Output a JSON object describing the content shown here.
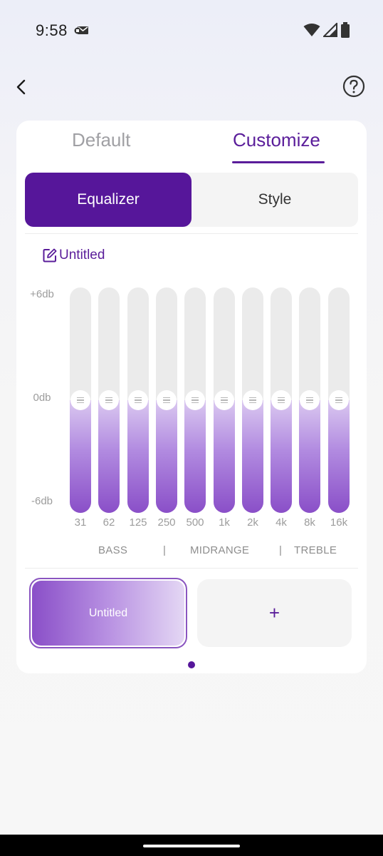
{
  "status_bar": {
    "time": "9:58",
    "icons": [
      "notification-icon",
      "wifi-icon",
      "signal-icon",
      "battery-icon"
    ]
  },
  "header": {
    "back_icon": "back-arrow-icon",
    "help_icon": "help-icon"
  },
  "tabs": {
    "default_label": "Default",
    "customize_label": "Customize",
    "active": "Customize"
  },
  "segments": {
    "equalizer_label": "Equalizer",
    "style_label": "Style",
    "active": "Equalizer"
  },
  "preset": {
    "name": "Untitled",
    "edit_icon": "edit-icon"
  },
  "equalizer": {
    "db_max_label": "+6db",
    "db_mid_label": "0db",
    "db_min_label": "-6db",
    "db_range": [
      -6,
      6
    ],
    "bands": [
      {
        "freq": "31",
        "gain_db": 0
      },
      {
        "freq": "62",
        "gain_db": 0
      },
      {
        "freq": "125",
        "gain_db": 0
      },
      {
        "freq": "250",
        "gain_db": 0
      },
      {
        "freq": "500",
        "gain_db": 0
      },
      {
        "freq": "1k",
        "gain_db": 0
      },
      {
        "freq": "2k",
        "gain_db": 0
      },
      {
        "freq": "4k",
        "gain_db": 0
      },
      {
        "freq": "8k",
        "gain_db": 0
      },
      {
        "freq": "16k",
        "gain_db": 0
      }
    ],
    "ranges": {
      "bass": "BASS",
      "separator": "|",
      "midrange": "MIDRANGE",
      "treble": "TREBLE"
    }
  },
  "preset_cards": {
    "selected_label": "Untitled",
    "add_label": "+"
  },
  "colors": {
    "accent": "#56169a",
    "accent_text": "#5a1d9a",
    "track": "#ebebeb"
  }
}
